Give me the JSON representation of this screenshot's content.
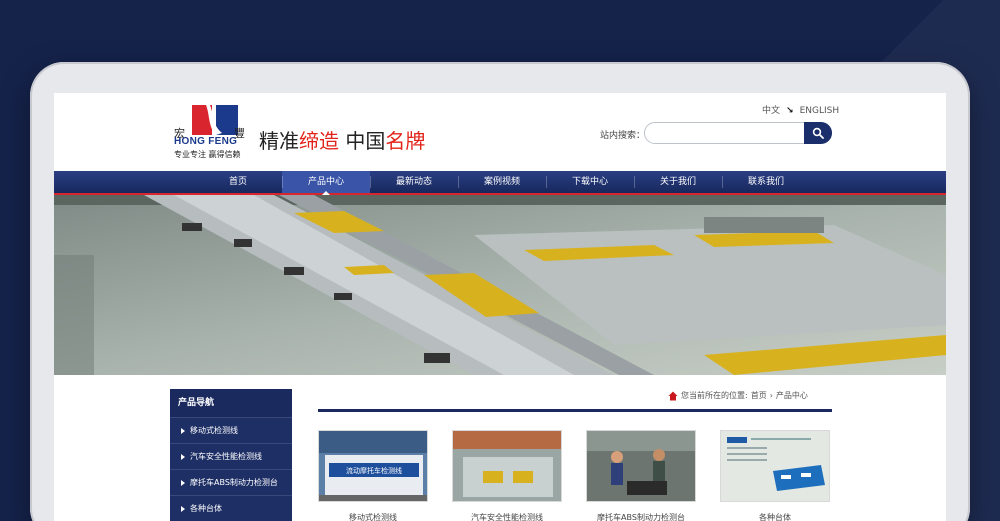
{
  "header": {
    "logo_cn_left": "宏",
    "logo_cn_right": "豐",
    "logo_en": "HONG FENG",
    "logo_tagline": "专业专注 赢得信赖",
    "slogan_part1": "精准",
    "slogan_part2": "缔造",
    "slogan_part3": "中国",
    "slogan_part4": "名牌",
    "lang_cn": "中文",
    "lang_en": "ENGLISH",
    "search_label": "站内搜索：",
    "search_value": ""
  },
  "nav": {
    "items": [
      {
        "label": "首页"
      },
      {
        "label": "产品中心"
      },
      {
        "label": "最新动态"
      },
      {
        "label": "案例视频"
      },
      {
        "label": "下载中心"
      },
      {
        "label": "关于我们"
      },
      {
        "label": "联系我们"
      }
    ],
    "active_index": 1
  },
  "sidebar": {
    "title": "产品导航",
    "items": [
      {
        "label": "移动式检测线"
      },
      {
        "label": "汽车安全性能检测线"
      },
      {
        "label": "摩托车ABS制动力检测台"
      },
      {
        "label": "各种台体"
      }
    ]
  },
  "breadcrumb": {
    "prefix": "您当前所在的位置:",
    "home": "首页",
    "current": "产品中心"
  },
  "products": [
    {
      "caption": "移动式检测线",
      "thumb_text": "流动摩托车检测线"
    },
    {
      "caption": "汽车安全性能检测线"
    },
    {
      "caption": "摩托车ABS制动力检测台"
    },
    {
      "caption": "各种台体"
    }
  ],
  "colors": {
    "page_bg": "#15224a",
    "brand_navy": "#1a2a5e",
    "accent_red": "#e2231a"
  }
}
